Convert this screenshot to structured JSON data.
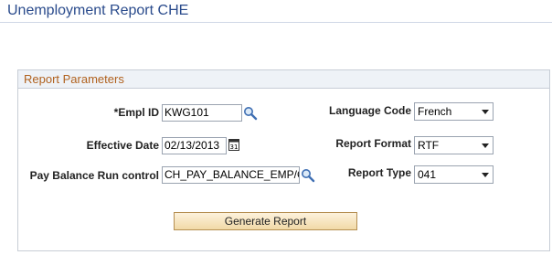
{
  "page": {
    "title": "Unemployment Report CHE"
  },
  "group": {
    "title": "Report Parameters"
  },
  "fields": {
    "empl_id": {
      "label": "*Empl ID",
      "value": "KWG101"
    },
    "effective_date": {
      "label": "Effective Date",
      "value": "02/13/2013"
    },
    "pay_balance": {
      "label": "Pay Balance Run control",
      "value": "CH_PAY_BALANCE_EMP/C"
    },
    "language_code": {
      "label": "Language Code",
      "value": "French"
    },
    "report_format": {
      "label": "Report Format",
      "value": "RTF"
    },
    "report_type": {
      "label": "Report Type",
      "value": "041"
    }
  },
  "icons": {
    "lookup": "magnifier-icon",
    "calendar": "calendar-icon",
    "calendar_text": "31"
  },
  "buttons": {
    "generate": "Generate Report"
  },
  "colors": {
    "title": "#2a4b8c",
    "group_title": "#b0611e",
    "button_top": "#fdf2dc",
    "button_bottom": "#f1d9a6"
  }
}
